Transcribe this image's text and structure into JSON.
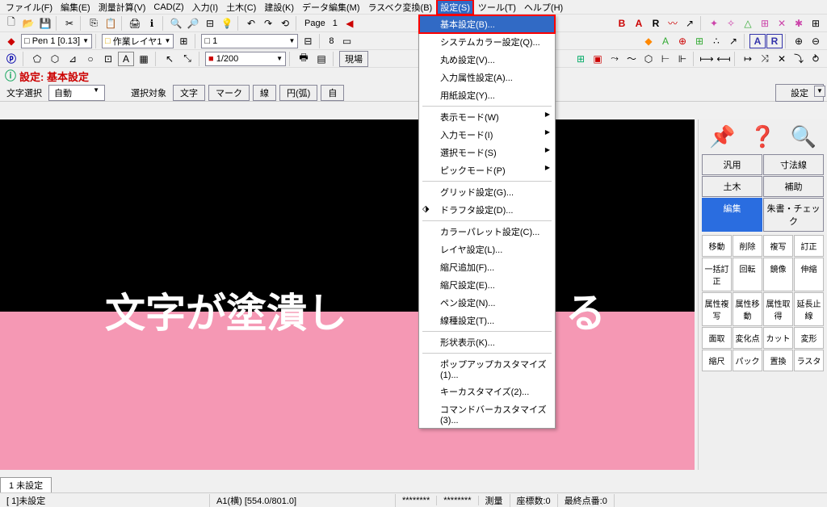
{
  "menubar": [
    "ファイル(F)",
    "編集(E)",
    "測量計算(V)",
    "CAD(Z)",
    "入力(I)",
    "土木(C)",
    "建設(K)",
    "データ編集(M)",
    "ラスベク変換(B)",
    "設定(S)",
    "ツール(T)",
    "ヘルプ(H)"
  ],
  "menubar_active_index": 9,
  "page_label": "Page",
  "page_num": "1",
  "pen": {
    "square": "□",
    "name": "Pen 1",
    "size": "[0.13]"
  },
  "layer": {
    "square": "□",
    "name": "作業レイヤ1"
  },
  "num_combo": "1",
  "eight": "8",
  "scale": "1/200",
  "site_btn": "現場",
  "title": "設定: 基本設定",
  "opt": {
    "txt_sel": "文字選択",
    "auto": "自動",
    "target": "選択対象",
    "moji": "文字",
    "mark": "マーク",
    "line": "線",
    "arc": "円(弧)",
    "free": "自",
    "set": "設定"
  },
  "canvas_text_left": "文字が塗潰し",
  "canvas_text_right": "る",
  "menu": {
    "items": [
      {
        "label": "基本設定(B)...",
        "hl": true
      },
      {
        "label": "システムカラー設定(Q)..."
      },
      {
        "label": "丸め設定(V)..."
      },
      {
        "label": "入力属性設定(A)..."
      },
      {
        "label": "用紙設定(Y)..."
      },
      {
        "sep": true
      },
      {
        "label": "表示モード(W)",
        "sub": true
      },
      {
        "label": "入力モード(I)",
        "sub": true
      },
      {
        "label": "選択モード(S)",
        "sub": true
      },
      {
        "label": "ピックモード(P)",
        "sub": true
      },
      {
        "sep": true
      },
      {
        "label": "グリッド設定(G)..."
      },
      {
        "label": "ドラフタ設定(D)...",
        "icon": "⬗"
      },
      {
        "sep": true
      },
      {
        "label": "カラーパレット設定(C)..."
      },
      {
        "label": "レイヤ設定(L)..."
      },
      {
        "label": "縮尺追加(F)..."
      },
      {
        "label": "縮尺設定(E)..."
      },
      {
        "label": "ペン設定(N)..."
      },
      {
        "label": "線種設定(T)..."
      },
      {
        "sep": true
      },
      {
        "label": "形状表示(K)..."
      },
      {
        "sep": true
      },
      {
        "label": "ポップアップカスタマイズ(1)..."
      },
      {
        "label": "キーカスタマイズ(2)..."
      },
      {
        "label": "コマンドバーカスタマイズ(3)..."
      }
    ]
  },
  "side": {
    "tabs": [
      [
        "汎用",
        "寸法線"
      ],
      [
        "土木",
        "補助"
      ],
      [
        "編集",
        "朱書・チェック"
      ]
    ],
    "tabs_active": "編集",
    "tools": [
      "移動",
      "削除",
      "複写",
      "訂正",
      "一括訂正",
      "回転",
      "鏡像",
      "伸縮",
      "属性複写",
      "属性移動",
      "属性取得",
      "延長止線",
      "面取",
      "変化点",
      "カット",
      "変形",
      "縮尺",
      "パック",
      "置換",
      "ラスタ"
    ]
  },
  "tabstrip": "1 未設定",
  "status": {
    "a": "[ 1]未設定",
    "b": "A1(横) [554.0/801.0]",
    "c": "********",
    "d": "********",
    "e": "測量",
    "f": "座標数:0",
    "g": "最終点番:0"
  }
}
